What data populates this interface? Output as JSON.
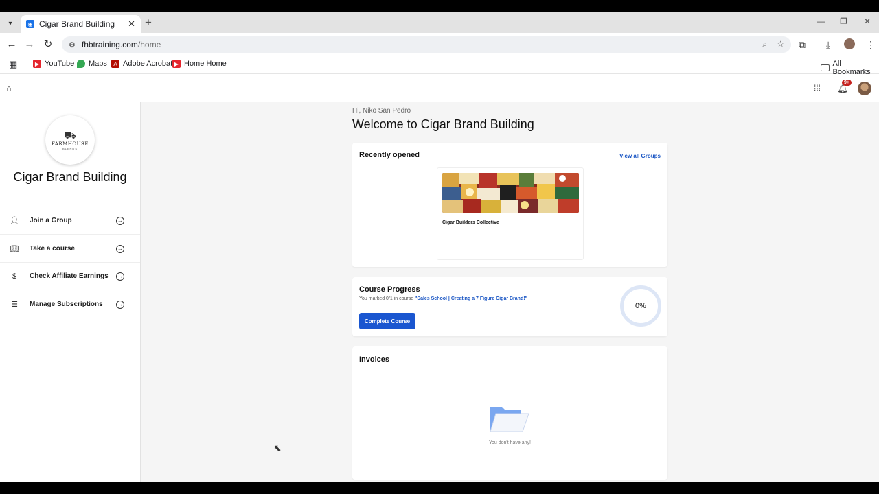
{
  "browser": {
    "tab_title": "Cigar Brand Building",
    "new_tab": "+",
    "url_host": "fhbtraining.com",
    "url_path": "/home",
    "bookmarks": [
      {
        "label": "YouTube",
        "color": "#e4252d"
      },
      {
        "label": "Maps",
        "color": "#34a853"
      },
      {
        "label": "Adobe Acrobat",
        "color": "#b30b00"
      },
      {
        "label": "Home Home",
        "color": "#e4252d"
      }
    ],
    "all_bookmarks": "All Bookmarks"
  },
  "header": {
    "notification_count": "9+"
  },
  "sidebar": {
    "logo_text": "FARMHOUSE",
    "logo_sub": "BLENDS",
    "title": "Cigar Brand Building",
    "items": [
      {
        "label": "Join a Group",
        "icon": "users-icon"
      },
      {
        "label": "Take a course",
        "icon": "book-icon"
      },
      {
        "label": "Check Affiliate Earnings",
        "icon": "dollar-icon"
      },
      {
        "label": "Manage Subscriptions",
        "icon": "receipt-icon"
      }
    ]
  },
  "main": {
    "greeting": "Hi, Niko San Pedro",
    "title": "Welcome to Cigar Brand Building",
    "recent": {
      "heading": "Recently opened",
      "view_all": "View all Groups",
      "group_name": "Cigar Builders Collective"
    },
    "progress": {
      "heading": "Course Progress",
      "sub_prefix": "You marked 0/1 in course",
      "course_name": "\"Sales School | Creating a 7 Figure Cigar Brand!\"",
      "button": "Complete Course",
      "percent": "0%"
    },
    "invoices": {
      "heading": "Invoices",
      "empty": "You don't have any!"
    }
  }
}
